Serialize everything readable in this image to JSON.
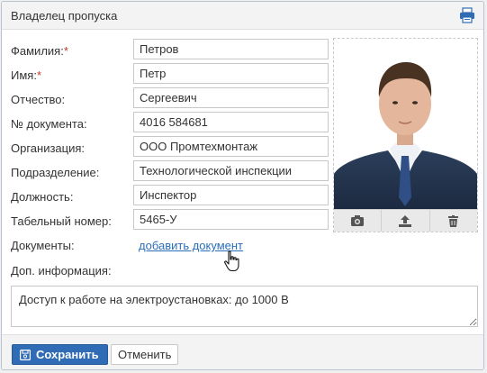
{
  "window": {
    "title": "Владелец пропуска"
  },
  "form": {
    "fields": [
      {
        "label": "Фамилия:",
        "required": "*",
        "value": "Петров"
      },
      {
        "label": "Имя:",
        "required": "*",
        "value": "Петр"
      },
      {
        "label": "Отчество:",
        "value": "Сергеевич"
      },
      {
        "label": "№ документа:",
        "value": "4016 584681"
      },
      {
        "label": "Организация:",
        "value": "ООО Промтехмонтаж"
      },
      {
        "label": "Подразделение:",
        "value": "Технологической инспекции"
      },
      {
        "label": "Должность:",
        "value": "Инспектор"
      },
      {
        "label": "Табельный номер:",
        "value": "5465-У"
      }
    ],
    "documents_label": "Документы:",
    "add_document_link": "добавить документ",
    "extra_info_label": "Доп. информация:",
    "extra_info_value": "Доступ к работе на электроустановках: до 1000 В"
  },
  "photo": {
    "toolbar": [
      "camera-icon",
      "upload-icon",
      "trash-icon"
    ]
  },
  "footer": {
    "save_label": "Сохранить",
    "cancel_label": "Отменить"
  },
  "colors": {
    "accent": "#2f6cb5",
    "link": "#2a6fbb",
    "required": "#c0392b"
  }
}
